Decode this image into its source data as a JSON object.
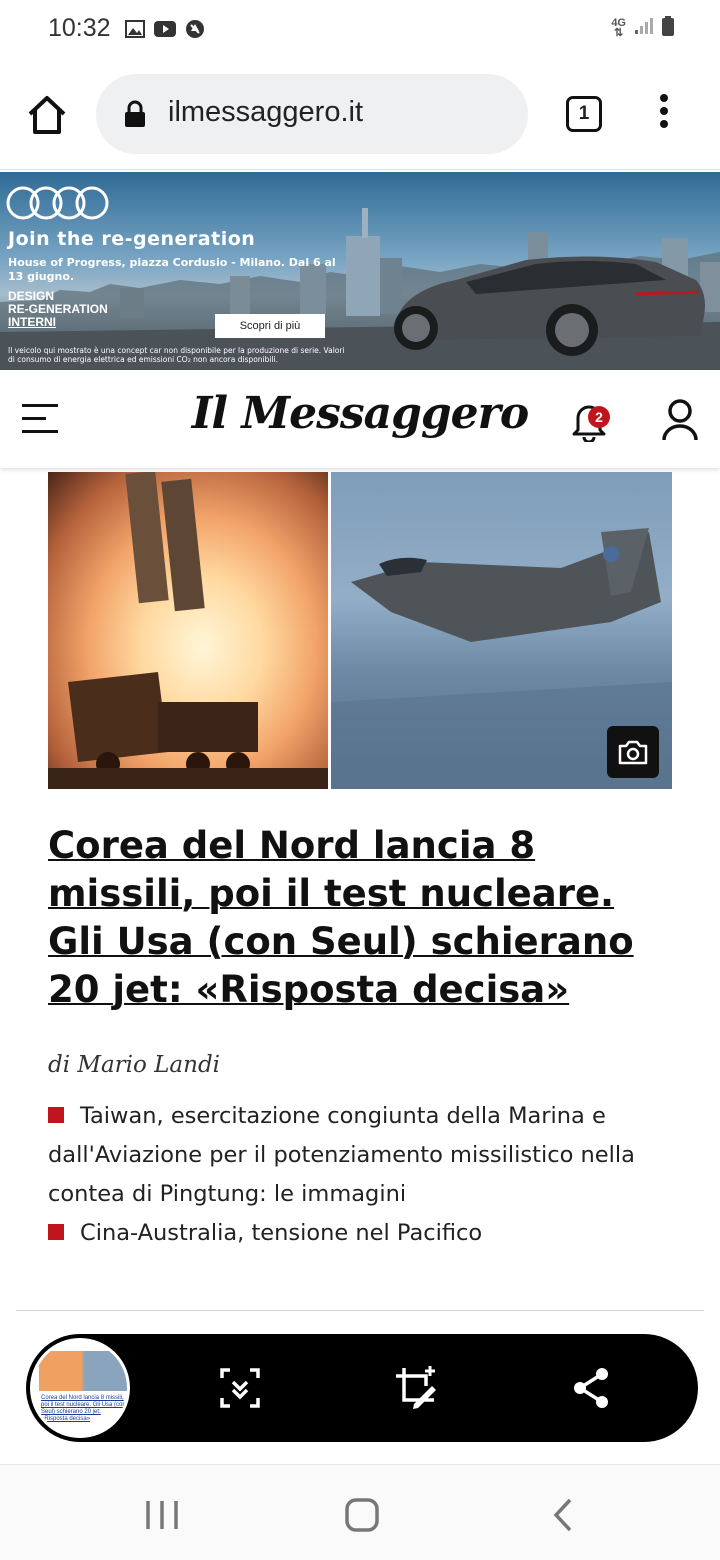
{
  "status_bar": {
    "time": "10:32",
    "network": "4G"
  },
  "browser": {
    "url": "ilmessaggero.it",
    "tab_count": "1"
  },
  "ad": {
    "title": "Join the re-generation",
    "subtitle": "House of Progress, piazza Cordusio - Milano. Dal 6 al 13 giugno.",
    "logo_lines": [
      "DESIGN",
      "RE-GENERATION",
      "INTERNI"
    ],
    "cta": "Scopri di più",
    "disclaimer": "Il veicolo qui mostrato è una concept car non disponibile per la produzione di serie. Valori di consumo di energia elettrica ed emissioni CO₂ non ancora disponibili."
  },
  "site": {
    "logo": "Il Messaggero",
    "notification_count": "2"
  },
  "article": {
    "headline": "Corea del Nord lancia 8 missili, poi il test nucleare. Gli Usa (con Seul) schierano 20 jet: «Risposta decisa»",
    "byline": "di Mario Landi",
    "related": [
      "Taiwan, esercitazione congiunta della Marina e dall'Aviazione per il potenziamento missilistico nella contea di Pingtung: le immagini",
      "Cina-Australia, tensione nel Pacifico"
    ]
  },
  "screenshot_toolbar": {
    "thumbnail_text": "Corea del Nord lancia 8 missili, poi il test nucleare. Gli Usa (con Seul) schierano 20 jet: «Risposta decisa»"
  },
  "colors": {
    "accent_red": "#c0151c",
    "toolbar_black": "#000000",
    "url_bar_bg": "#eef0f2"
  },
  "icons": [
    "image-icon",
    "youtube-icon",
    "blocked-icon",
    "signal-icon",
    "battery-icon",
    "home-icon",
    "lock-icon",
    "more-options-icon",
    "hamburger-icon",
    "bell-icon",
    "user-icon",
    "camera-icon",
    "scroll-capture-icon",
    "crop-edit-icon",
    "share-icon",
    "recents-icon",
    "home-nav-icon",
    "back-icon"
  ]
}
